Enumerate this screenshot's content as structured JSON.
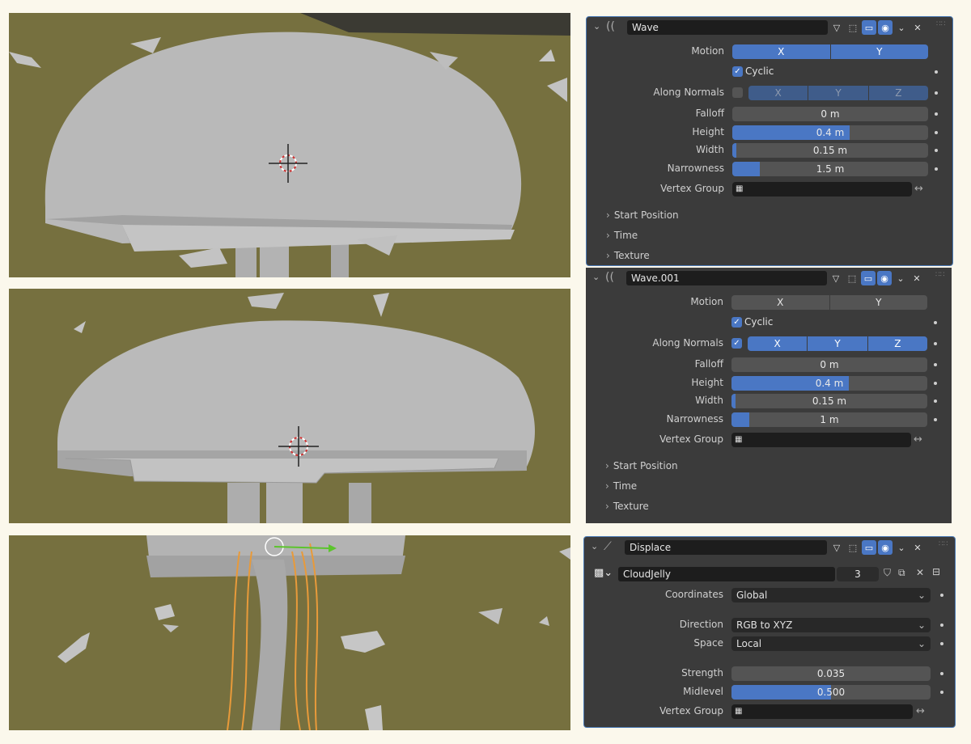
{
  "wave1": {
    "name": "Wave",
    "motion_label": "Motion",
    "motion_x": "X",
    "motion_y": "Y",
    "cyclic": "Cyclic",
    "along_normals_label": "Along Normals",
    "an_x": "X",
    "an_y": "Y",
    "an_z": "Z",
    "falloff_label": "Falloff",
    "falloff": "0 m",
    "height_label": "Height",
    "height": "0.4 m",
    "width_label": "Width",
    "width": "0.15 m",
    "narrowness_label": "Narrowness",
    "narrowness": "1.5 m",
    "vertex_group_label": "Vertex Group",
    "start_position": "Start Position",
    "time": "Time",
    "texture": "Texture"
  },
  "wave2": {
    "name": "Wave.001",
    "motion_label": "Motion",
    "motion_x": "X",
    "motion_y": "Y",
    "cyclic": "Cyclic",
    "along_normals_label": "Along Normals",
    "an_x": "X",
    "an_y": "Y",
    "an_z": "Z",
    "falloff_label": "Falloff",
    "falloff": "0 m",
    "height_label": "Height",
    "height": "0.4 m",
    "width_label": "Width",
    "width": "0.15 m",
    "narrowness_label": "Narrowness",
    "narrowness": "1 m",
    "vertex_group_label": "Vertex Group",
    "start_position": "Start Position",
    "time": "Time",
    "texture": "Texture"
  },
  "displace": {
    "name": "Displace",
    "texture_name": "CloudJelly",
    "texture_users": "3",
    "coordinates_label": "Coordinates",
    "coordinates": "Global",
    "direction_label": "Direction",
    "direction": "RGB to XYZ",
    "space_label": "Space",
    "space": "Local",
    "strength_label": "Strength",
    "strength": "0.035",
    "midlevel_label": "Midlevel",
    "midlevel": "0.500",
    "vertex_group_label": "Vertex Group"
  },
  "icons": [
    "wave-modifier-icon",
    "displace-modifier-icon",
    "edit-mode-icon",
    "cage-icon",
    "realtime-icon",
    "render-icon",
    "close-icon",
    "vertex-group-icon",
    "swap-icon",
    "checker-texture-icon",
    "fake-user-icon",
    "duplicate-icon"
  ],
  "colors": {
    "accent": "#4a77c4",
    "panel": "#3b3b3b",
    "field": "#545454",
    "ground": "#76703f",
    "mesh": "#b9b9b9"
  }
}
